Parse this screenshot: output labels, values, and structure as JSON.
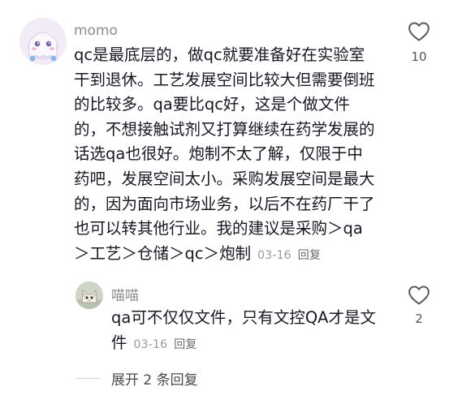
{
  "comments": [
    {
      "username": "momo",
      "lines": [
        "qc是最底层的，做qc就要准备好在实验室",
        "干到退休。工艺发展空间比较大但需要倒班",
        "的比较多。qa要比qc好，这是个做文件",
        "的，不想接触试剂又打算继续在药学发展的",
        "话选qa也很好。炮制不太了解，仅限于中",
        "药吧，发展空间太小。采购发展空间是最大",
        "的，因为面向市场业务，以后不在药厂干了",
        "也可以转其他行业。我的建议是采购＞qa"
      ],
      "last_line": "＞工艺＞仓储＞qc＞炮制",
      "date": "03-16",
      "reply_label": "回复",
      "like_count": "10",
      "avatar_icon": "cartoon-ghost-avatar",
      "like_icon": "heart-outline-icon"
    },
    {
      "username": "喵喵",
      "lines": [
        "qa可不仅仅文件，只有文控QA才是文"
      ],
      "last_line": "件",
      "date": "03-16",
      "reply_label": "回复",
      "like_count": "2",
      "avatar_icon": "cat-photo-avatar",
      "like_icon": "heart-outline-icon"
    }
  ],
  "expand_replies": {
    "label": "展开 2 条回复",
    "icon": "chevron-down-icon"
  },
  "colors": {
    "text": "#161823",
    "muted": "#9a9a9a",
    "background": "#ffffff"
  }
}
